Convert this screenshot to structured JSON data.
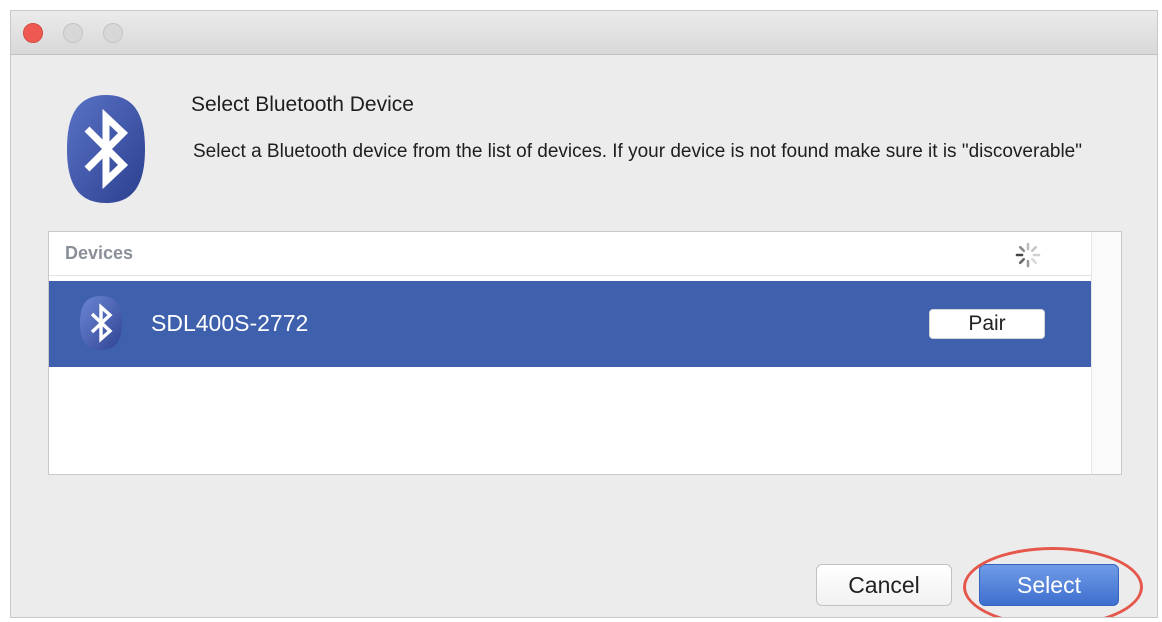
{
  "dialog": {
    "heading": "Select Bluetooth Device",
    "description": "Select a Bluetooth device from the list of devices. If your device is not found make sure it is \"discoverable\""
  },
  "devices": {
    "title": "Devices",
    "items": [
      {
        "name": "SDL400S-2772",
        "action_label": "Pair",
        "selected": true
      }
    ]
  },
  "buttons": {
    "cancel_label": "Cancel",
    "select_label": "Select"
  },
  "icons": {
    "app_icon": "bluetooth-icon",
    "device_icon": "bluetooth-icon",
    "loading_indicator": "spinner-icon"
  },
  "colors": {
    "selected_row": "#3f61ad",
    "default_button": "#4a78d6",
    "highlight_ring": "#e4574a",
    "bluetooth_badge": "#3b4fa0"
  }
}
